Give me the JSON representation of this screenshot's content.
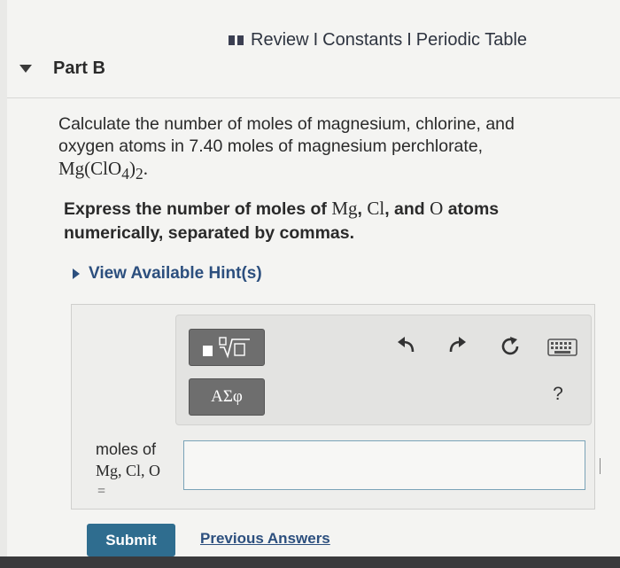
{
  "header_links": {
    "review": "Review",
    "constants": "Constants",
    "periodic_table": "Periodic Table",
    "separator": "I"
  },
  "part": {
    "label": "Part B"
  },
  "question": {
    "line1": "Calculate the number of moles of magnesium, chlorine, and oxygen atoms in 7.40 moles of magnesium perchlorate,",
    "formula_main": "Mg(ClO",
    "formula_sub4": "4",
    "formula_close": ")",
    "formula_sub2": "2",
    "formula_end": "."
  },
  "instruction": {
    "prefix": "Express the number of moles of ",
    "mg": "Mg",
    "comma1": ", ",
    "cl": "Cl",
    "and": ", and ",
    "o": "O",
    "suffix": " atoms numerically, separated by commas."
  },
  "hint": {
    "label": "View Available Hint(s)"
  },
  "toolbar": {
    "symbols_label": "ΑΣφ",
    "help_label": "?",
    "icons": [
      "templates-icon",
      "undo-icon",
      "redo-icon",
      "reset-icon",
      "keyboard-icon",
      "help-icon"
    ]
  },
  "answer": {
    "label_line1": "moles of",
    "label_line2": "Mg, Cl, O",
    "label_eq": "=",
    "value": ""
  },
  "actions": {
    "submit": "Submit",
    "previous_answers": "Previous Answers"
  },
  "colors": {
    "submit_bg": "#2f6d8f",
    "link": "#2c4f7e",
    "input_border": "#7aa3b7"
  }
}
